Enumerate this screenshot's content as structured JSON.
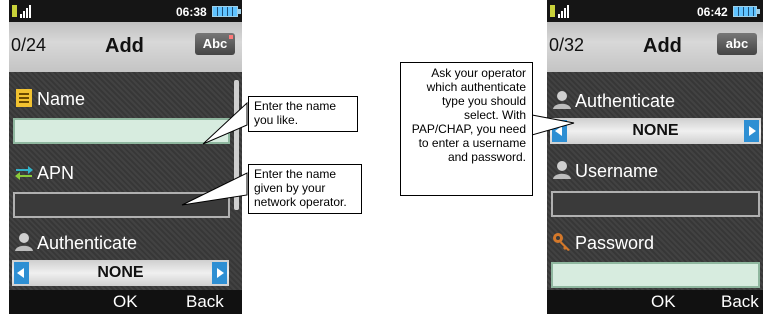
{
  "left_screen": {
    "status": {
      "time": "06:38"
    },
    "header": {
      "counter": "0/24",
      "title": "Add",
      "input_mode": "Abc"
    },
    "fields": {
      "name_label": "Name",
      "name_value": "",
      "apn_label": "APN",
      "apn_value": "",
      "authenticate_label": "Authenticate",
      "authenticate_value": "NONE"
    },
    "softkeys": {
      "ok": "OK",
      "back": "Back"
    }
  },
  "right_screen": {
    "status": {
      "time": "06:42"
    },
    "header": {
      "counter": "0/32",
      "title": "Add",
      "input_mode": "abc"
    },
    "fields": {
      "authenticate_label": "Authenticate",
      "authenticate_value": "NONE",
      "username_label": "Username",
      "username_value": "",
      "password_label": "Password",
      "password_value": ""
    },
    "softkeys": {
      "ok": "OK",
      "back": "Back"
    }
  },
  "callouts": {
    "name": "Enter the name you like.",
    "apn": "Enter the name given by your network operator.",
    "auth": "Ask your operator which authenticate type you should select. With PAP/CHAP, you need to enter a username and password."
  },
  "icons": {
    "name": "notepad-icon",
    "apn": "transfer-arrows-icon",
    "authenticate": "user-icon",
    "username": "user-icon",
    "password": "key-icon"
  },
  "colors": {
    "accent_blue": "#2e8fd3",
    "active_field": "#d7ecdf",
    "phone_bg": "#3a3a3a"
  }
}
